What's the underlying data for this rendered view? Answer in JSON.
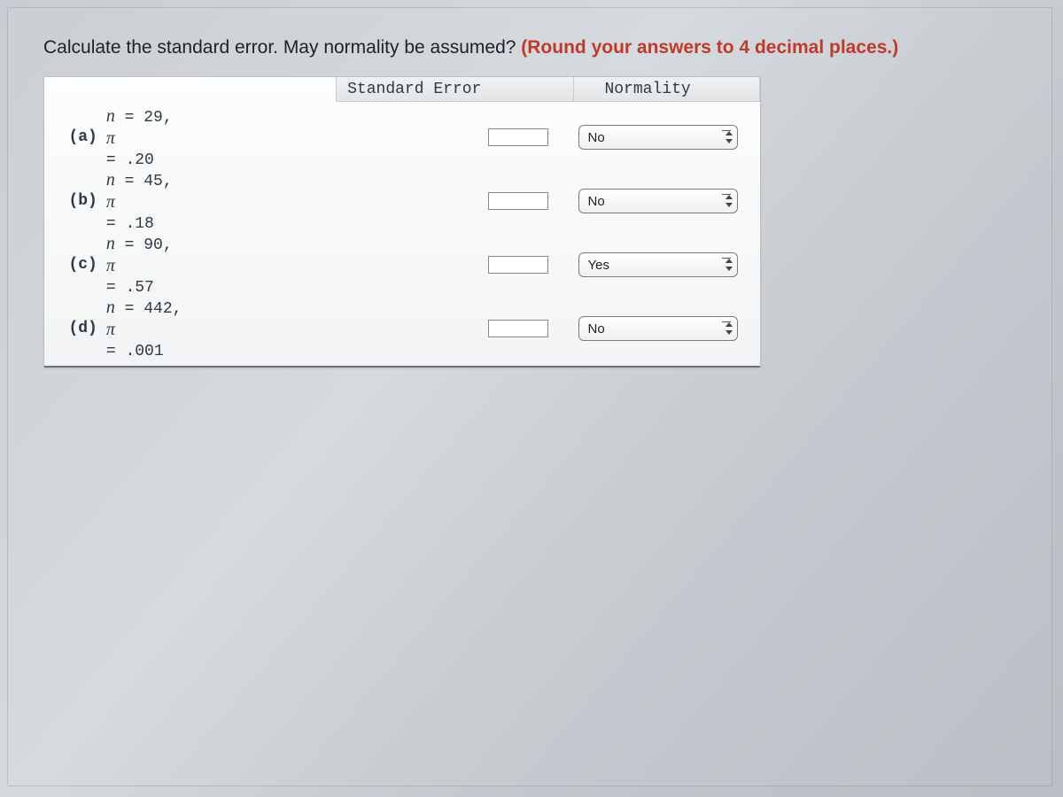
{
  "question": {
    "part1": "Calculate the standard error. May normality be assumed? ",
    "part2": "(Round your answers to 4 decimal places.)"
  },
  "headers": {
    "se": "Standard Error",
    "norm": "Normality"
  },
  "rows": [
    {
      "label": "(a)",
      "n": "29",
      "pi": ".20",
      "norm_value": "No"
    },
    {
      "label": "(b)",
      "n": "45",
      "pi": ".18",
      "norm_value": "No"
    },
    {
      "label": "(c)",
      "n": "90",
      "pi": ".57",
      "norm_value": "Yes"
    },
    {
      "label": "(d)",
      "n": "442",
      "pi": ".001",
      "norm_value": "No"
    }
  ],
  "norm_options": [
    "No",
    "Yes"
  ]
}
